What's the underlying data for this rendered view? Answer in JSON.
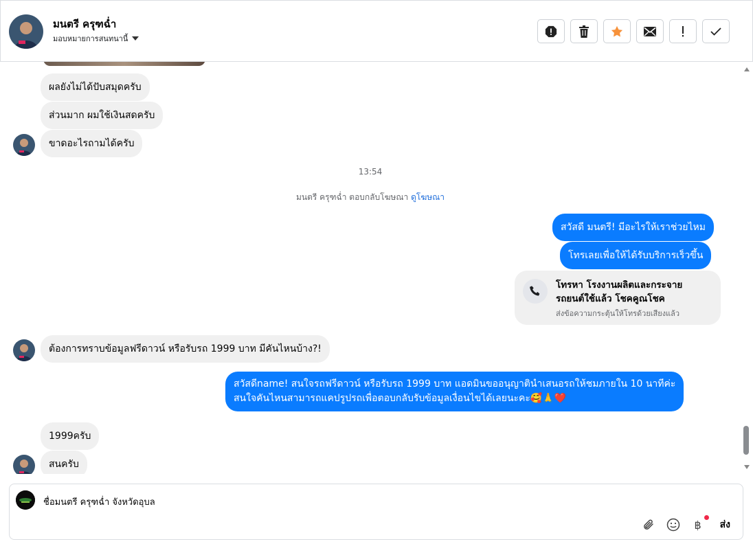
{
  "header": {
    "contact_name": "มนตรี ครุฑฉ่ำ",
    "assign_label": "มอบหมายการสนทนานี้",
    "actions": [
      "alert-icon",
      "trash-icon",
      "star-icon",
      "mail-icon",
      "exclamation-icon",
      "check-icon"
    ],
    "star_color": "#f7923b"
  },
  "messages": {
    "m1": "ผลยังไม่ได้ปับสมุดครับ",
    "m2": "ส่วนมาก ผมใช้เงินสดครับ",
    "m3": "ขาดอะไรถามได้ครับ",
    "timestamp": "13:54",
    "system_text": "มนตรี ครุฑฉ่ำ ตอบกลับโฆษณา",
    "system_link": "ดูโฆษณา",
    "o1": "สวัสดี มนตรี! มีอะไรให้เราช่วยไหม",
    "o2": "โทรเลยเพื่อให้ได้รับบริการเร็วขึ้น",
    "call_title": "โทรหา โรงงานผลิตและกระจายรถยนต์ใช้แล้ว โชคคูณโชค",
    "call_sub": "ส่งข้อความกระตุ้นให้โทรด้วยเสียงแล้ว",
    "m4": "ต้องการทราบข้อมูลฟรีดาวน์ หรือรับรถ 1999 บาท มีคันไหนบ้าง?!",
    "o3_line1": "สวัสดีname! สนใจรถฟรีดาวน์ หรือรับรถ 1999 บาท แอดมินขออนุญาตินำเสนอรถให้ชมภายใน 10 นาทีค่ะ",
    "o3_line2": "สนใจคันไหนสามารถแคปรูปรถเพื่อตอบกลับรับข้อมูลเงื่อนไขได้เลยนะคะ🥰🙏❤️",
    "m5": "1999ครับ",
    "m6": "สนครับ"
  },
  "composer": {
    "text": "ชื่อมนตรี ครุฑฉ่ำ จังหวัดอุบล",
    "send_label": "ส่ง",
    "baht_symbol": "฿"
  },
  "colors": {
    "outgoing": "#0a7cff",
    "incoming": "#f0f0f0",
    "link": "#216fdb"
  }
}
